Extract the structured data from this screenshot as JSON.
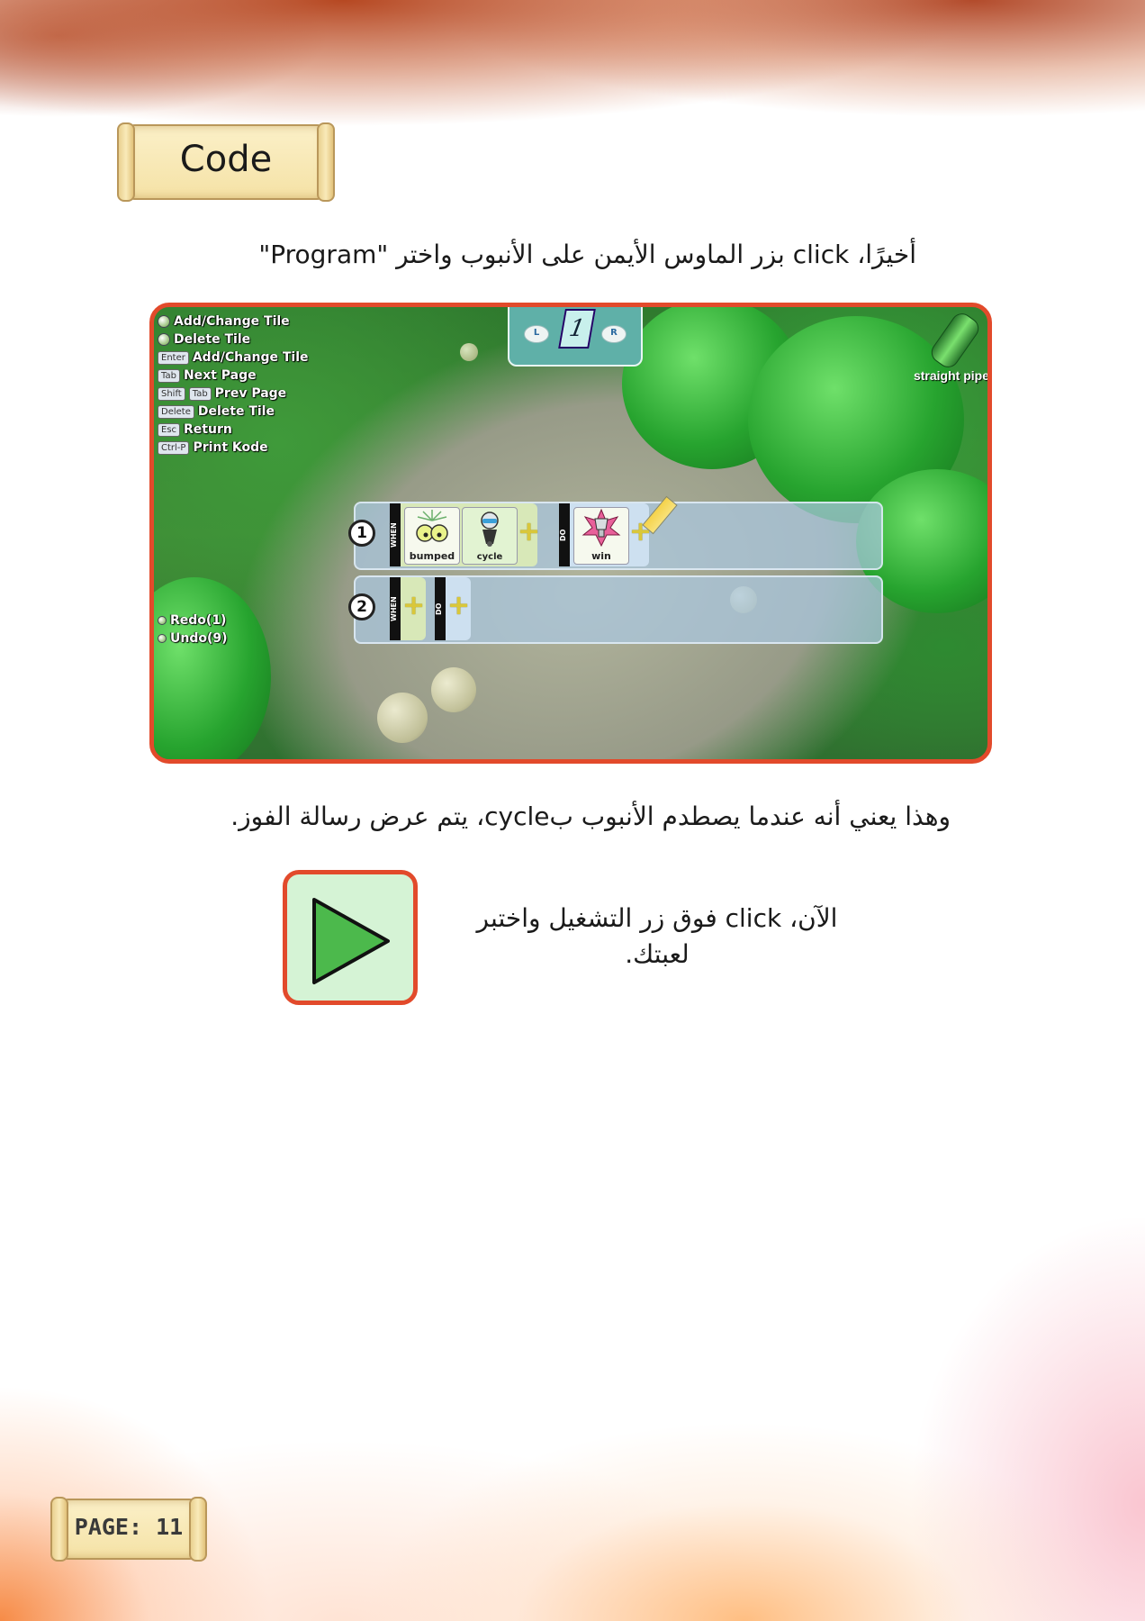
{
  "header": {
    "title": "Code"
  },
  "paragraphs": {
    "intro": "أخيرًا، click بزر الماوس الأيمن على الأنبوب واختر \"Program\"",
    "explain": "وهذا يعني أنه عندما يصطدم الأنبوب بcycle، يتم عرض رسالة الفوز.",
    "play": "الآن، click فوق زر التشغيل واختبر لعبتك."
  },
  "screenshot": {
    "hud": [
      {
        "key": "",
        "label": "Add/Change Tile",
        "icon": "mouse-left-icon"
      },
      {
        "key": "",
        "label": "Delete Tile",
        "icon": "mouse-right-icon"
      },
      {
        "key": "Enter",
        "label": "Add/Change Tile"
      },
      {
        "key": "Tab",
        "label": "Next Page"
      },
      {
        "key": "Shift",
        "key2": "Tab",
        "label": "Prev Page"
      },
      {
        "key": "Delete",
        "label": "Delete Tile"
      },
      {
        "key": "Esc",
        "label": "Return"
      },
      {
        "key": "Ctrl-P",
        "label": "Print Kode"
      }
    ],
    "page_tab": {
      "left": "L",
      "page": "1",
      "right": "R"
    },
    "object_label": "straight pipe",
    "history": {
      "redo": "Redo(1)",
      "undo": "Undo(9)"
    },
    "rules": [
      {
        "number": "1",
        "when_label": "WHEN",
        "do_label": "DO",
        "when_tiles": [
          "bumped",
          "cycle"
        ],
        "do_tiles": [
          "win"
        ]
      },
      {
        "number": "2",
        "when_label": "WHEN",
        "do_label": "DO",
        "when_tiles": [],
        "do_tiles": []
      }
    ]
  },
  "footer": {
    "page_label": "PAGE: 11"
  },
  "colors": {
    "accent_border": "#e24a2b",
    "play_green": "#4cb94c"
  }
}
